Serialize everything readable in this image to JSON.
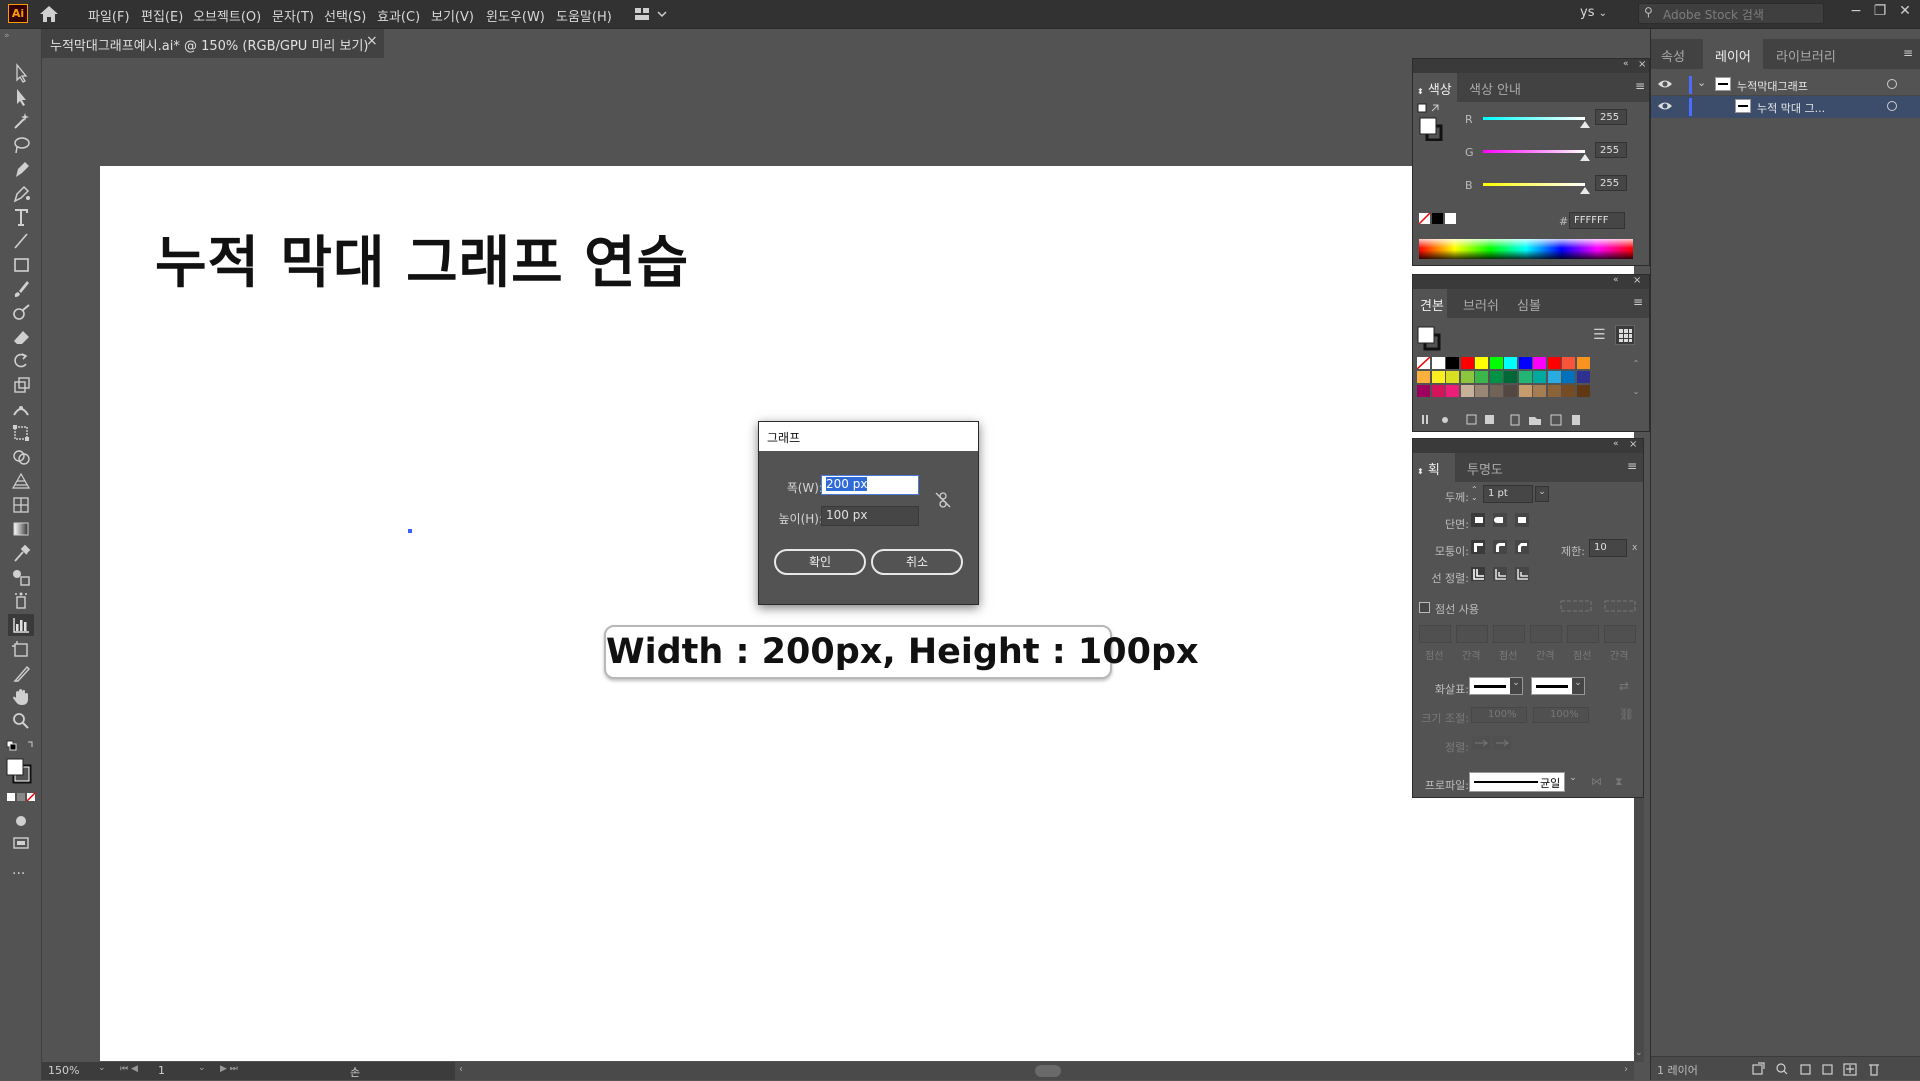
{
  "app": {
    "logo": "Ai",
    "menu": [
      "파일(F)",
      "편집(E)",
      "오브젝트(O)",
      "문자(T)",
      "선택(S)",
      "효과(C)",
      "보기(V)",
      "윈도우(W)",
      "도움말(H)"
    ],
    "user": "ys",
    "stock_search_placeholder": "Adobe Stock 검색"
  },
  "document": {
    "tab_title": "누적막대그래프예시.ai* @ 150% (RGB/GPU 미리 보기)"
  },
  "artboard": {
    "heading": "누적 막대 그래프 연습",
    "callout": "Width : 200px, Height : 100px"
  },
  "graph_dialog": {
    "title": "그래프",
    "width_label": "폭(W):",
    "width_value": "200 px",
    "height_label": "높이(H):",
    "height_value": "100 px",
    "ok_label": "확인",
    "cancel_label": "취소"
  },
  "color_panel": {
    "tabs": [
      "색상",
      "색상 안내"
    ],
    "channels": [
      {
        "name": "R",
        "value": "255",
        "color": "#00ffff"
      },
      {
        "name": "G",
        "value": "255",
        "color": "#ff00ff"
      },
      {
        "name": "B",
        "value": "255",
        "color": "#ffff00"
      }
    ],
    "hex_symbol": "#",
    "hex_value": "FFFFFF"
  },
  "swatches_panel": {
    "tabs": [
      "견본",
      "브러쉬",
      "심볼"
    ],
    "rows": [
      [
        "#ffffff",
        "#ffffff",
        "#000000",
        "#ff0000",
        "#ffff00",
        "#00ff00",
        "#00ffff",
        "#0000ff",
        "#ff00ff",
        "#ff0000",
        "#f7553a",
        "#f7931e"
      ],
      [
        "#fbb03b",
        "#fcee21",
        "#d9e021",
        "#8cc63f",
        "#39b54a",
        "#009245",
        "#006837",
        "#22b573",
        "#00a99d",
        "#29abe2",
        "#0071bc",
        "#2e3192"
      ],
      [
        "#9e005d",
        "#d4145a",
        "#ed1e79",
        "#c7b299",
        "#998675",
        "#736357",
        "#534741",
        "#c69c6d",
        "#a67c52",
        "#8c6239",
        "#754c24",
        "#603813"
      ]
    ]
  },
  "stroke_panel": {
    "tabs": [
      "획",
      "투명도"
    ],
    "weight_label": "두께:",
    "weight_value": "1 pt",
    "cap_label": "단면:",
    "corner_label": "모퉁이:",
    "limit_label": "제한:",
    "limit_value": "10",
    "align_label": "선 정렬:",
    "dashed_label": "점선 사용",
    "dash_labels": [
      "점선",
      "간격",
      "점선",
      "간격",
      "점선",
      "간격"
    ],
    "arrow_label": "화살표:",
    "scale_label": "크기 조절:",
    "scale_values": [
      "100%",
      "100%"
    ],
    "arrange_label": "정렬:",
    "profile_label": "프로파일:",
    "profile_value": "균일"
  },
  "layers_panel": {
    "tabs": [
      "속성",
      "레이어",
      "라이브러리"
    ],
    "layers": [
      {
        "name": "누적막대그래프"
      },
      {
        "name": "누적 막대 그..."
      }
    ],
    "footer": "1 레이어"
  },
  "status": {
    "zoom": "150%",
    "artboard_num": "1",
    "tool": "손"
  }
}
